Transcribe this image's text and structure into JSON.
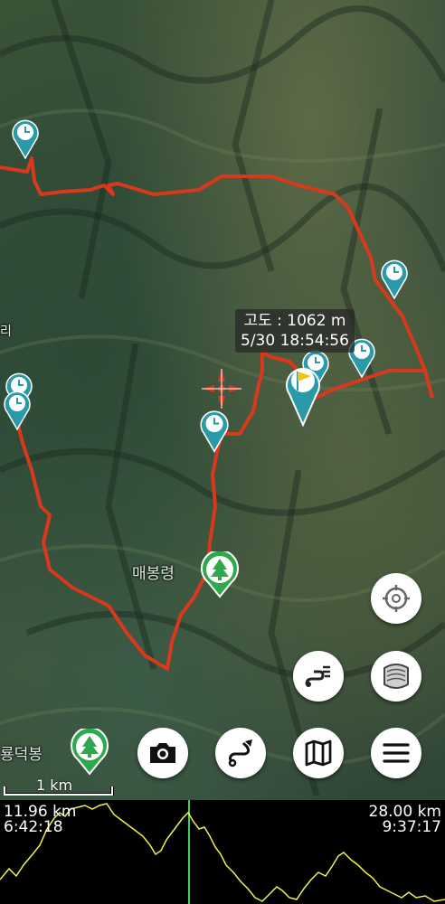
{
  "map": {
    "track_color": "#d8391c",
    "pin_color": "#2a9aa8",
    "flag_color": "#f2c40f",
    "poi_color": "#2ea84d"
  },
  "tooltip": {
    "altitude": "고도 : 1062 m",
    "datetime": "5/30 18:54:56"
  },
  "labels": {
    "peak1": "매봉령",
    "peak2": "룡덕봉",
    "edge": "리"
  },
  "scale_bar": {
    "label": "1 km"
  },
  "buttons": {
    "locate": "crosshair-icon",
    "track_list": "track-list-icon",
    "layers": "layers-icon",
    "camera": "camera-icon",
    "route": "route-icon",
    "map": "map-icon",
    "menu": "menu-icon"
  },
  "profile": {
    "left_distance": "11.96 km",
    "left_time": "6:42:18",
    "right_distance": "28.00 km",
    "right_time": "9:37:17",
    "line_color": "#f2f04a",
    "cursor_color": "#3fcf5a"
  }
}
